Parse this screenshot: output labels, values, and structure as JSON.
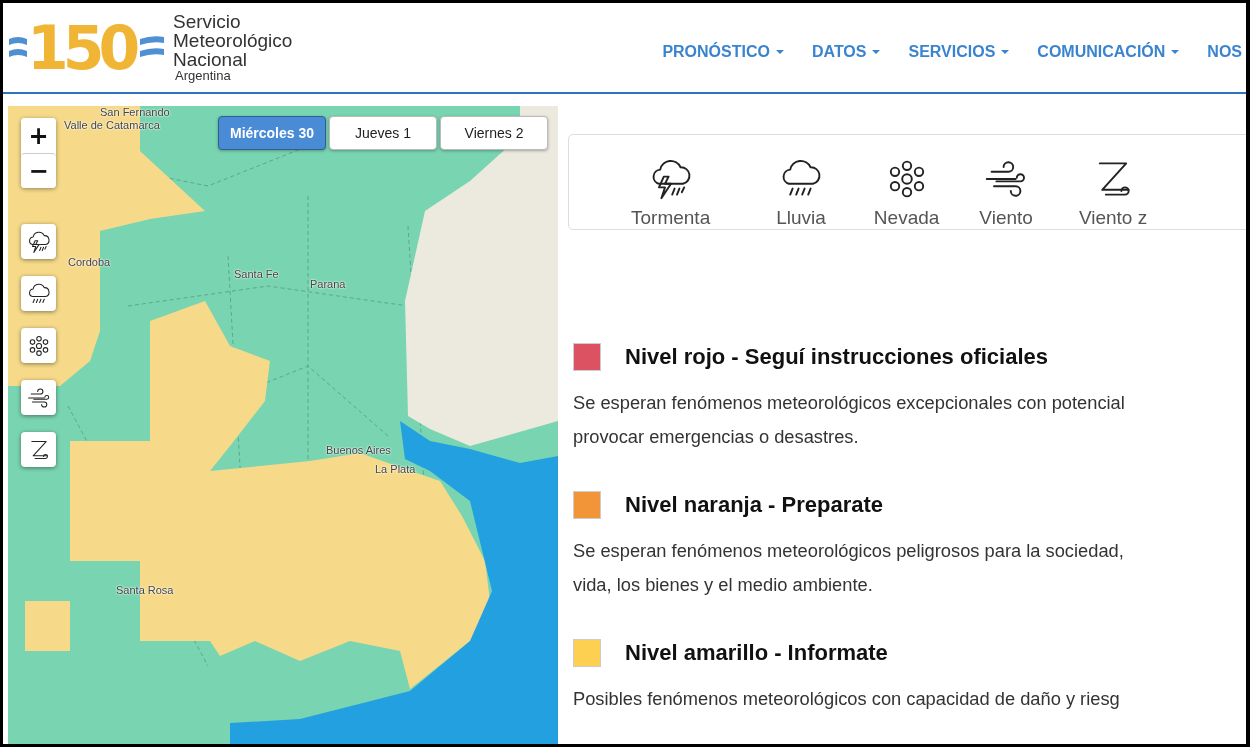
{
  "header": {
    "logo_mark": "150",
    "logo_lines": [
      "Servicio",
      "Meteorológico",
      "Nacional"
    ],
    "logo_sub": "Argentina",
    "nav": [
      {
        "label": "PRONÓSTICO",
        "dropdown": true
      },
      {
        "label": "DATOS",
        "dropdown": true
      },
      {
        "label": "SERVICIOS",
        "dropdown": true
      },
      {
        "label": "COMUNICACIÓN",
        "dropdown": true
      },
      {
        "label": "NOS",
        "dropdown": false
      }
    ]
  },
  "map": {
    "zoom_in": "+",
    "zoom_out": "−",
    "days": [
      {
        "label": "Miércoles 30",
        "selected": true
      },
      {
        "label": "Jueves 1",
        "selected": false
      },
      {
        "label": "Viernes 2",
        "selected": false
      }
    ],
    "layers": [
      {
        "kind": "storm"
      },
      {
        "kind": "rain"
      },
      {
        "kind": "snow"
      },
      {
        "kind": "wind"
      },
      {
        "kind": "zonda"
      }
    ],
    "labels": [
      "San Fernando",
      "Valle de Catamarca",
      "Cordoba",
      "Santa Fe",
      "Parana",
      "Buenos Aires",
      "La Plata",
      "Santa Rosa"
    ]
  },
  "legend": [
    {
      "kind": "storm",
      "label": "Tormenta"
    },
    {
      "kind": "rain",
      "label": "Lluvia"
    },
    {
      "kind": "snow",
      "label": "Nevada"
    },
    {
      "kind": "wind",
      "label": "Viento"
    },
    {
      "kind": "zonda",
      "label": "Viento z"
    }
  ],
  "levels": [
    {
      "title": "Nivel rojo - Seguí instrucciones oficiales",
      "color": "#dc5263",
      "lines": [
        "Se esperan fenómenos meteorológicos excepcionales con potencial",
        "provocar emergencias o desastres."
      ]
    },
    {
      "title": "Nivel naranja - Preparate",
      "color": "#f19538",
      "lines": [
        "Se esperan fenómenos meteorológicos peligrosos para la sociedad,",
        "vida, los bienes y el medio ambiente."
      ]
    },
    {
      "title": "Nivel amarillo - Informate",
      "color": "#fdd052",
      "lines": [
        "Posibles fenómenos meteorológicos con capacidad de daño y riesg"
      ]
    }
  ]
}
